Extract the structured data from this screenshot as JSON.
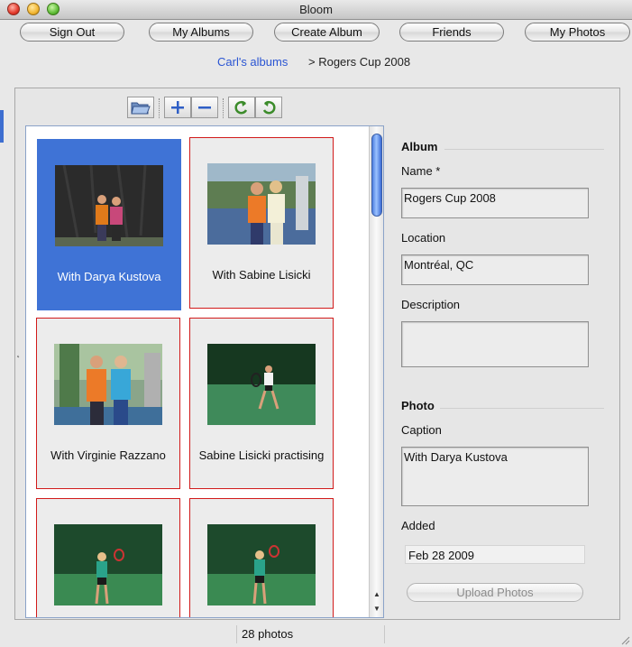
{
  "window": {
    "title": "Bloom"
  },
  "nav": {
    "sign_out": "Sign Out",
    "my_albums": "My Albums",
    "create_album": "Create Album",
    "friends": "Friends",
    "my_photos": "My Photos"
  },
  "breadcrumb": {
    "link": "Carl's albums",
    "current": "> Rogers Cup 2008"
  },
  "toolbar": {
    "icons": [
      "open-folder-icon",
      "add-icon",
      "remove-icon",
      "rotate-left-icon",
      "rotate-right-icon"
    ]
  },
  "photos": [
    {
      "caption": "With Darya Kustova",
      "selected": true,
      "scene": "tarp"
    },
    {
      "caption": "With Sabine Lisicki",
      "selected": false,
      "scene": "court-pose"
    },
    {
      "caption": "With Virginie Razzano",
      "selected": false,
      "scene": "fence-pose"
    },
    {
      "caption": "Sabine Lisicki practising",
      "selected": false,
      "scene": "practice"
    },
    {
      "caption": "",
      "selected": false,
      "scene": "player"
    },
    {
      "caption": "",
      "selected": false,
      "scene": "player"
    }
  ],
  "album": {
    "section_title": "Album",
    "name_label": "Name *",
    "name_value": "Rogers Cup 2008",
    "location_label": "Location",
    "location_value": "Montréal, QC",
    "description_label": "Description",
    "description_value": ""
  },
  "photo": {
    "section_title": "Photo",
    "caption_label": "Caption",
    "caption_value": "With Darya Kustova",
    "added_label": "Added",
    "added_value": "Feb 28 2009",
    "upload_label": "Upload Photos"
  },
  "status": {
    "count": "28 photos"
  },
  "colors": {
    "selection": "#3f73d6",
    "tile_border": "#d11a1a",
    "link": "#2a55d3"
  }
}
